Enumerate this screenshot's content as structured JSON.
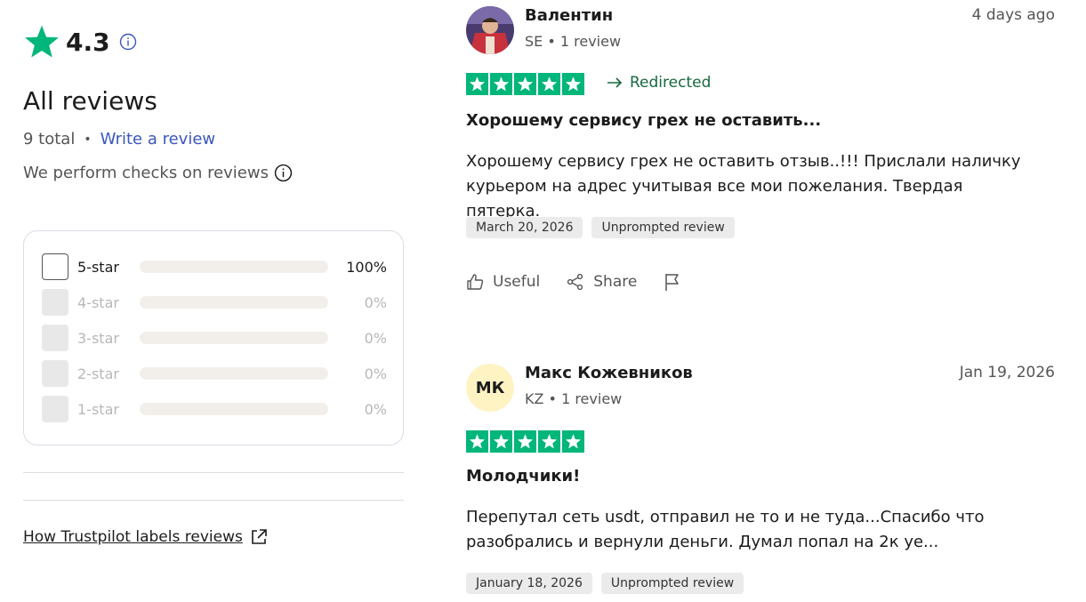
{
  "summary": {
    "rating": "4.3",
    "title": "All reviews",
    "total": "9 total",
    "separator": "•",
    "write_review": "Write a review",
    "checks_text": "We perform checks on reviews",
    "how_link": "How Trustpilot labels reviews"
  },
  "distribution": [
    {
      "label": "5-star",
      "percent": "100%",
      "fraction": 1.0,
      "active": true
    },
    {
      "label": "4-star",
      "percent": "0%",
      "fraction": 0,
      "active": false
    },
    {
      "label": "3-star",
      "percent": "0%",
      "fraction": 0,
      "active": false
    },
    {
      "label": "2-star",
      "percent": "0%",
      "fraction": 0,
      "active": false
    },
    {
      "label": "1-star",
      "percent": "0%",
      "fraction": 0,
      "active": false
    }
  ],
  "reviews": [
    {
      "name": "Валентин",
      "meta": "SE • 1 review",
      "date": "4 days ago",
      "stars": 5,
      "redirected": "Redirected",
      "title": "Хорошему сервису грех не оставить...",
      "body": "Хорошему сервису грех не оставить отзыв..!!! Прислали наличку курьером на адрес учитывая все мои пожелания. Твердая пятерка.",
      "chips": [
        "March 20, 2026",
        "Unprompted review"
      ],
      "useful": "Useful",
      "share": "Share"
    },
    {
      "name": "Макс Кожевников",
      "initials": "МК",
      "meta": "KZ • 1 review",
      "date": "Jan 19, 2026",
      "stars": 5,
      "title": "Молодчики!",
      "body": "Перепутал сеть usdt, отправил не то и не туда...Спасибо что разобрались и вернули деньги. Думал попал на 2к уе...",
      "chips": [
        "January 18, 2026",
        "Unprompted review"
      ]
    }
  ],
  "colors": {
    "trustpilot_green": "#00b67a",
    "link_blue": "#3c57bc",
    "redirected_green": "#17683e",
    "bar_fill": "#1f2a22"
  }
}
